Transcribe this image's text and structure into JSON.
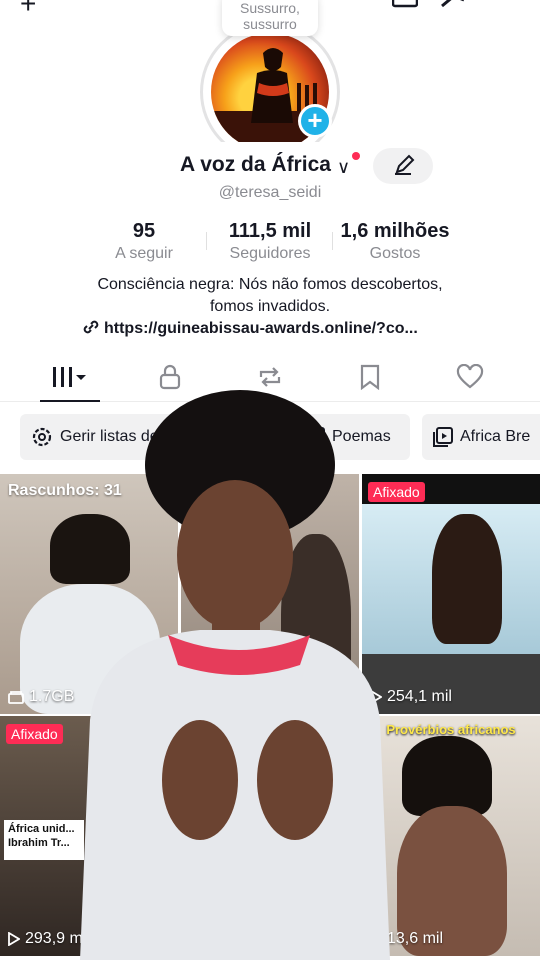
{
  "bubble": {
    "line1": "Sussurro,",
    "line2": "sussurro"
  },
  "profile": {
    "name": "A voz da África",
    "handle": "@teresa_seidi"
  },
  "stats": [
    {
      "value": "95",
      "label": "A seguir"
    },
    {
      "value": "111,5 mil",
      "label": "Seguidores"
    },
    {
      "value": "1,6 milhões",
      "label": "Gostos"
    }
  ],
  "bio": {
    "line1": "Consciência negra: Nós não fomos descobertos,",
    "line2": "fomos invadidos.",
    "link": "https://guineabissau-awards.online/?co..."
  },
  "tabs": [
    {
      "icon": "grid-icon",
      "active": true
    },
    {
      "icon": "lock-icon"
    },
    {
      "icon": "repost-icon"
    },
    {
      "icon": "bookmark-icon"
    },
    {
      "icon": "heart-icon"
    }
  ],
  "chips": [
    {
      "label": "Gerir listas de reprodução",
      "icon": "gear-icon"
    },
    {
      "label": "Poemas",
      "icon": "playlist-icon"
    },
    {
      "label": "Africa Bre",
      "icon": "playlist-icon"
    }
  ],
  "grid": [
    {
      "top_text": "Rascunhos: 31",
      "bottom_text": "1.7GB",
      "bottom_icon": "storage-icon"
    },
    {
      "top_text": "",
      "bottom_text": ""
    },
    {
      "badge": "Afixado",
      "bottom_text": "254,1 mil",
      "bottom_icon": "play-icon"
    },
    {
      "badge": "Afixado",
      "bottom_text": "293,9 mil",
      "bottom_icon": "play-icon",
      "thumb_title": "África unid... Ibrahim Tr..."
    },
    {
      "bottom_text": ""
    },
    {
      "caption": "Provérbios africanos",
      "bottom_text": "13,6 mil",
      "bottom_icon": "play-icon"
    }
  ]
}
